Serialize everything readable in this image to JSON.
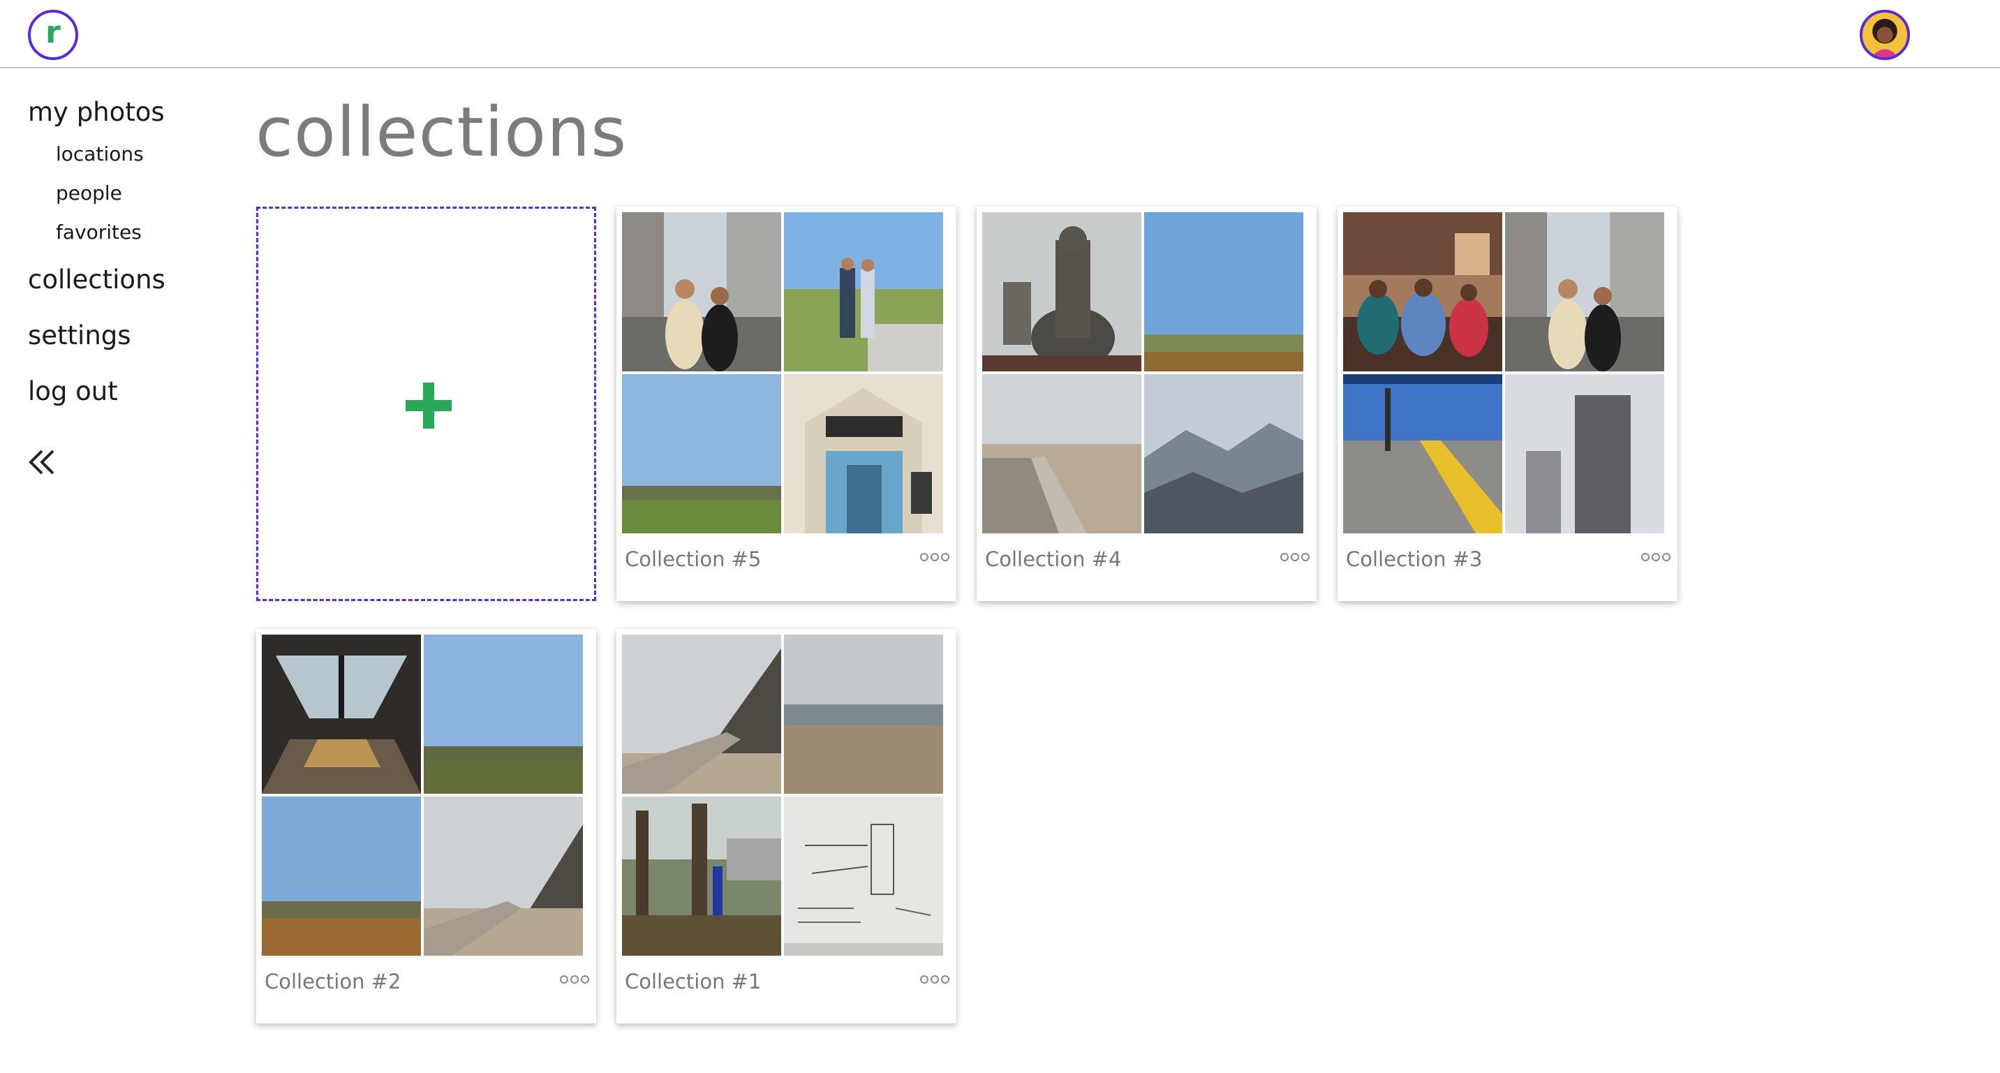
{
  "header": {
    "logo_letter": "r",
    "logo_icon": "r-logo-icon",
    "avatar_icon": "user-avatar-icon"
  },
  "sidebar": {
    "main_items": [
      {
        "label": "my photos"
      },
      {
        "label": "collections"
      },
      {
        "label": "settings"
      },
      {
        "label": "log out"
      }
    ],
    "sub_items": [
      {
        "label": "locations"
      },
      {
        "label": "people"
      },
      {
        "label": "favorites"
      }
    ],
    "collapse_icon": "double-chevron-left-icon"
  },
  "main": {
    "title": "collections",
    "new_collection_icon": "plus-icon",
    "collections": [
      {
        "label": "Collection #5"
      },
      {
        "label": "Collection #4"
      },
      {
        "label": "Collection #3"
      },
      {
        "label": "Collection #2"
      },
      {
        "label": "Collection #1"
      }
    ],
    "more_icon": "more-options-icon"
  },
  "colors": {
    "brand_purple": "#5b2bd6",
    "brand_green": "#29a85a",
    "title_gray": "#7c7c7c",
    "label_gray": "#777777"
  }
}
